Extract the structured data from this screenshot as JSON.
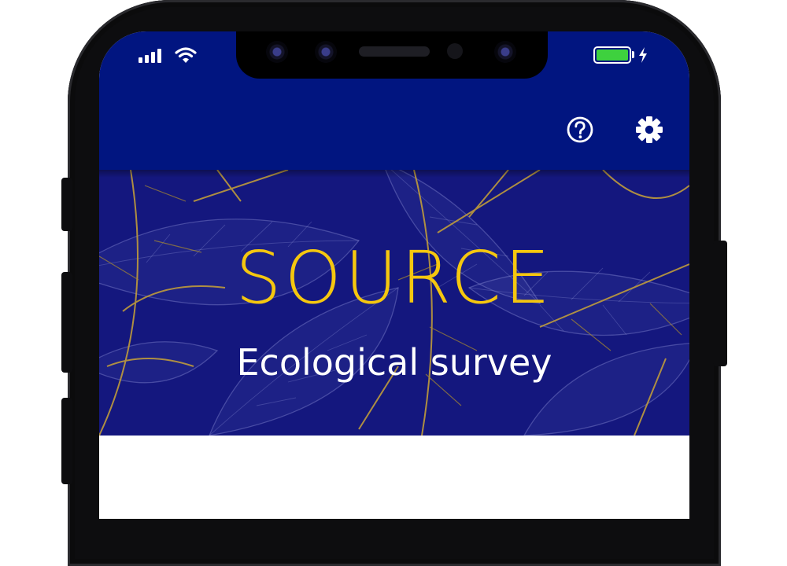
{
  "header": {
    "title": "SOURCE",
    "subtitle": "Ecological survey"
  },
  "actions": [
    {
      "label": "help",
      "icon": "help-circle-icon"
    },
    {
      "label": "settings",
      "icon": "gear-icon"
    }
  ],
  "status_bar": {
    "signal_icon": "cellular-signal-icon",
    "wifi_icon": "wifi-icon",
    "battery_icon": "battery-icon",
    "charging_icon": "charging-bolt-icon",
    "battery_level": 1.0
  },
  "colors": {
    "app_bar": "#011580",
    "hero_background": "#14177e",
    "brand": "#f5c70f",
    "tagline": "#ffffff",
    "battery": "#3ed13e"
  }
}
